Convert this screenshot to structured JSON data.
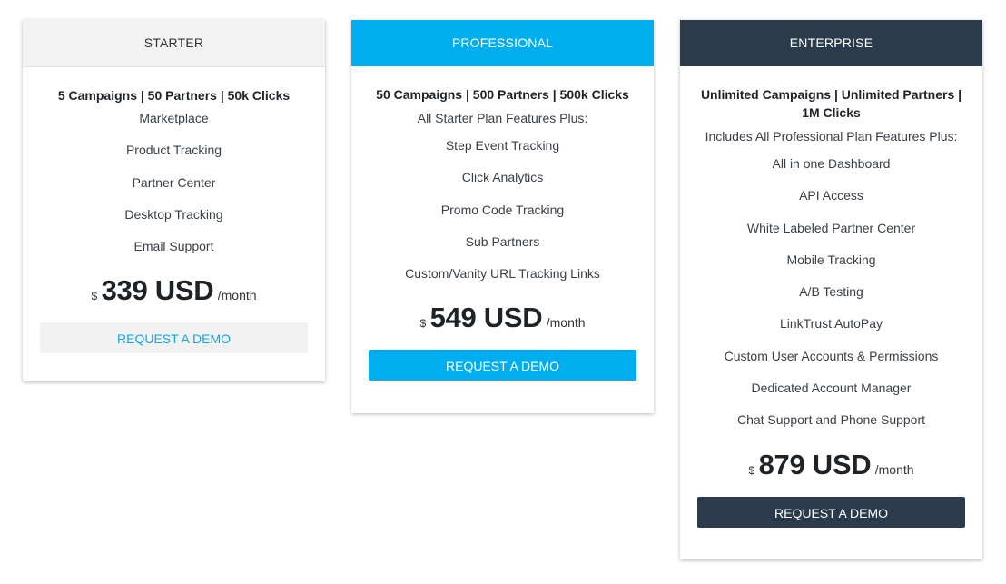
{
  "plans": [
    {
      "name": "STARTER",
      "headline": "5 Campaigns | 50 Partners | 50k Clicks",
      "intro": "",
      "features": [
        "Marketplace",
        "Product Tracking",
        "Partner Center",
        "Desktop Tracking",
        "Email Support"
      ],
      "currency_symbol": "$",
      "price": "339 USD",
      "period": "/month",
      "cta_label": "REQUEST A DEMO"
    },
    {
      "name": "PROFESSIONAL",
      "headline": "50 Campaigns | 500 Partners | 500k Clicks",
      "intro": "All Starter Plan Features Plus:",
      "features": [
        "Step Event Tracking",
        "Click Analytics",
        "Promo Code Tracking",
        "Sub Partners",
        "Custom/Vanity URL Tracking Links"
      ],
      "currency_symbol": "$",
      "price": "549 USD",
      "period": "/month",
      "cta_label": "REQUEST A DEMO"
    },
    {
      "name": "ENTERPRISE",
      "headline": "Unlimited Campaigns | Unlimited Partners | 1M Clicks",
      "intro": "Includes All Professional Plan Features Plus:",
      "features": [
        "All in one Dashboard",
        "API Access",
        "White Labeled Partner Center",
        "Mobile Tracking",
        "A/B Testing",
        "LinkTrust AutoPay",
        "Custom User Accounts & Permissions",
        "Dedicated Account Manager",
        "Chat Support and Phone Support"
      ],
      "currency_symbol": "$",
      "price": "879 USD",
      "period": "/month",
      "cta_label": "REQUEST A DEMO"
    }
  ],
  "colors": {
    "starter_header": "#f3f3f3",
    "professional_accent": "#00adee",
    "enterprise_accent": "#2b3b4b"
  }
}
